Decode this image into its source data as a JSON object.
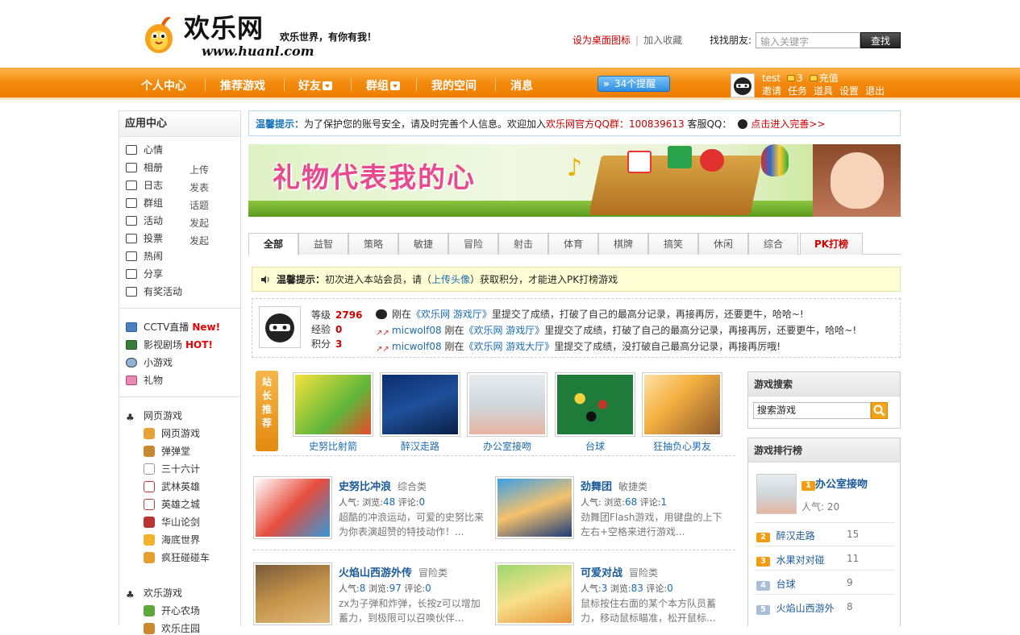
{
  "header": {
    "logo_title": "欢乐网",
    "slogan": "欢乐世界，有你有我！",
    "url": "www.huanl.com",
    "set_desktop": "设为桌面图标",
    "separator": "|",
    "bookmark": "加入收藏",
    "find_label": "找找朋友:",
    "find_placeholder": "输入关键字",
    "find_button": "查找"
  },
  "nav": {
    "items": [
      "个人中心",
      "推荐游戏",
      "好友",
      "群组",
      "我的空间",
      "消息"
    ],
    "reminder": "34个提醒",
    "user": {
      "name": "test",
      "coins": "3",
      "recharge": "充值",
      "links": [
        "邀请",
        "任务",
        "道具",
        "设置",
        "退出"
      ]
    }
  },
  "sidebar": {
    "title": "应用中心",
    "apps": [
      {
        "label": "心情",
        "sub": ""
      },
      {
        "label": "相册",
        "sub": "上传"
      },
      {
        "label": "日志",
        "sub": "发表"
      },
      {
        "label": "群组",
        "sub": "话题"
      },
      {
        "label": "活动",
        "sub": "发起"
      },
      {
        "label": "投票",
        "sub": "发起"
      },
      {
        "label": "热闹",
        "sub": ""
      },
      {
        "label": "分享",
        "sub": ""
      },
      {
        "label": "有奖活动",
        "sub": ""
      }
    ],
    "media": [
      {
        "label": "CCTV直播",
        "badge": "New!"
      },
      {
        "label": "影视剧场",
        "badge": "HOT!"
      },
      {
        "label": "小游戏",
        "badge": ""
      },
      {
        "label": "礼物",
        "badge": ""
      }
    ],
    "web_games_title": "网页游戏",
    "web_games": [
      "网页游戏",
      "弹弹堂",
      "三十六计",
      "武林英雄",
      "英雄之城",
      "华山论剑",
      "海底世界",
      "疯狂碰碰车"
    ],
    "fun_games_title": "欢乐游戏",
    "fun_games": [
      "开心农场",
      "欢乐庄园"
    ]
  },
  "notice1": {
    "label": "温馨提示：",
    "text": "为了保护您的账号安全，请及时完善个人信息。欢迎加入",
    "qq_group": "欢乐网官方QQ群：",
    "qq_number": "100839613",
    "service": "客服QQ：",
    "link": "点击进入完善>>"
  },
  "banner": {
    "text": "礼物代表我的心"
  },
  "tabs": [
    "全部",
    "益智",
    "策略",
    "敏捷",
    "冒险",
    "射击",
    "体育",
    "棋牌",
    "搞笑",
    "休闲",
    "综合",
    "PK打榜"
  ],
  "notice2": {
    "label": "温馨提示：",
    "text1": "初次进入本站会员，请（",
    "link": "上传头像",
    "text2": "）获取积分，才能进入PK打榜游戏"
  },
  "profile": {
    "level_label": "等级",
    "level": "2796",
    "exp_label": "经验",
    "exp": "0",
    "points_label": "积分",
    "points": "3",
    "feeds": [
      {
        "user": "",
        "pre": "刚在",
        "game": "《欢乐网 游戏厅》",
        "post": "里提交了成绩，打破了自己的最高分记录，再接再厉，还要更牛，哈哈~!"
      },
      {
        "user": "micwolf08",
        "pre": "刚在",
        "game": "《欢乐网 游戏厅》",
        "post": "里提交了成绩，打破了自己的最高分记录，再接再厉，还要更牛，哈哈~!"
      },
      {
        "user": "micwolf08",
        "pre": "刚在",
        "game": "《欢乐网 游戏大厅》",
        "post": "里提交了成绩，没打破自己最高分记录，再接再厉哦!"
      }
    ]
  },
  "recommend": {
    "label": "站长推荐",
    "items": [
      "史努比射箭",
      "醉汉走路",
      "办公室接吻",
      "台球",
      "狂抽负心男友"
    ]
  },
  "games": [
    {
      "name": "史努比冲浪",
      "cat": "综合类",
      "pop_label": "人气:",
      "pop": "",
      "views_label": "浏览:",
      "views": "48",
      "comments_label": "评论:",
      "comments": "0",
      "desc": "超酷的冲浪运动，可爱的史努比来为你表演超赞的特技动作！..."
    },
    {
      "name": "劲舞团",
      "cat": "敏捷类",
      "pop_label": "人气:",
      "pop": "",
      "views_label": "浏览:",
      "views": "68",
      "comments_label": "评论:",
      "comments": "1",
      "desc": "劲舞团Flash游戏，用键盘的上下左右+空格来进行游戏..."
    },
    {
      "name": "火焰山西游外传",
      "cat": "冒险类",
      "pop_label": "人气:",
      "pop": "8",
      "views_label": "浏览:",
      "views": "97",
      "comments_label": "评论:",
      "comments": "0",
      "desc": "zx为子弹和炸弹，长按z可以增加蓄力，到极限可以召唤伙伴..."
    },
    {
      "name": "可爱对战",
      "cat": "冒险类",
      "pop_label": "人气:",
      "pop": "3",
      "views_label": "浏览:",
      "views": "83",
      "comments_label": "评论:",
      "comments": "0",
      "desc": "鼠标按住右面的某个本方队员蓄力，移动鼠标瞄准，松开鼠标..."
    }
  ],
  "search": {
    "title": "游戏搜索",
    "value": "搜索游戏"
  },
  "ranking": {
    "title": "游戏排行榜",
    "top": {
      "rank": "1",
      "name": "办公室接吻",
      "pop_label": "人气:",
      "pop": "20"
    },
    "rows": [
      {
        "rank": "2",
        "name": "醉汉走路",
        "count": "15"
      },
      {
        "rank": "3",
        "name": "水果对对碰",
        "count": "11"
      },
      {
        "rank": "4",
        "name": "台球",
        "count": "9"
      },
      {
        "rank": "5",
        "name": "火焰山西游外",
        "count": "8"
      }
    ]
  },
  "colors": {
    "accent": "#ee7d00",
    "link": "#1b6bb0",
    "red": "#cc0000"
  }
}
